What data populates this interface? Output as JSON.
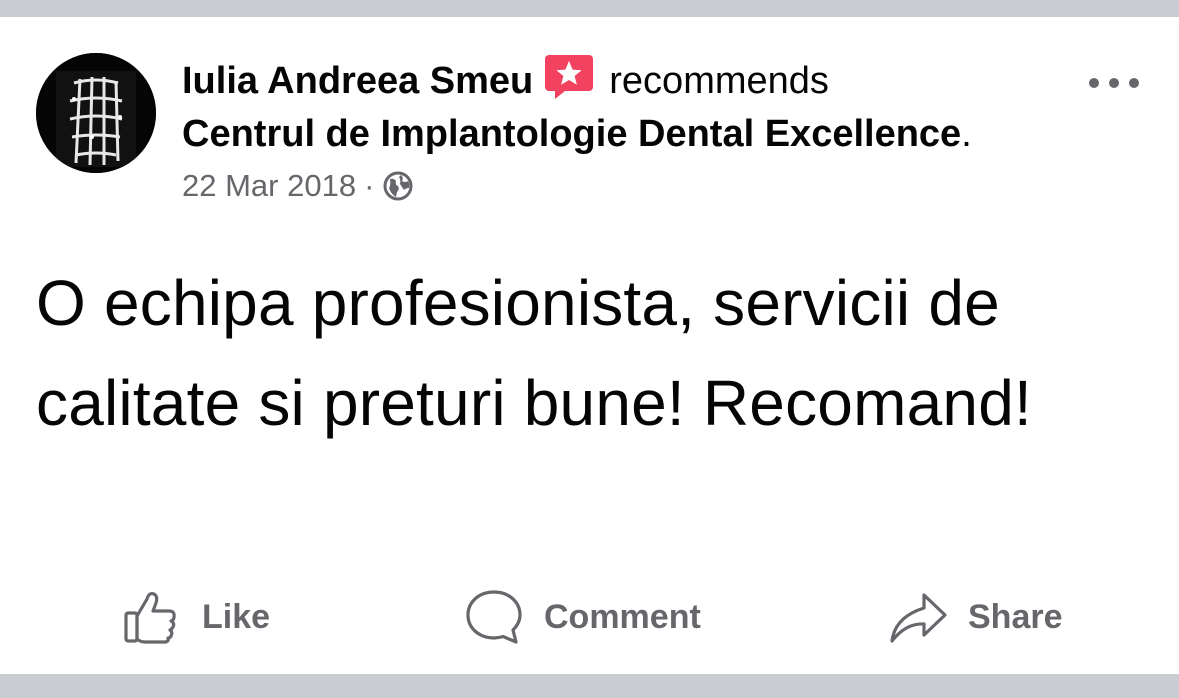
{
  "post": {
    "author_name": "Iulia Andreea Smeu",
    "recommends_text": "recommends",
    "page_name": "Centrul de Implantologie Dental Excellence",
    "page_suffix": ".",
    "date": "22 Mar 2018",
    "meta_separator": "·",
    "audience_icon": "globe-icon",
    "badge_icon": "recommend-star-badge-icon",
    "more_icon": "more-options-icon",
    "body_text": "O echipa profesionista, servicii de calitate si preturi bune! Recomand!"
  },
  "actions": {
    "like_label": "Like",
    "comment_label": "Comment",
    "share_label": "Share"
  },
  "colors": {
    "badge_pink": "#f3425f",
    "secondary_text": "#65676b",
    "primary_text": "#050505",
    "divider_band": "#c9ccd1"
  }
}
